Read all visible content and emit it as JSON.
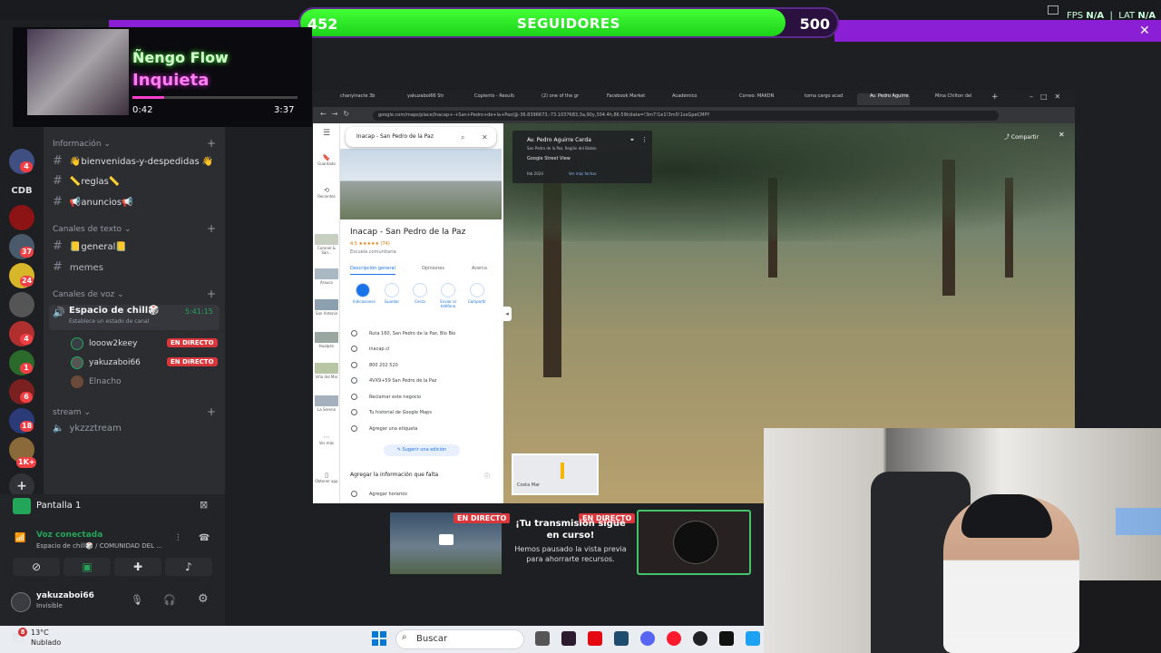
{
  "follower_goal": {
    "current": "452",
    "label": "SEGUIDORES",
    "goal": "500",
    "progress": 0.904
  },
  "obs_stats": {
    "fps_label": "FPS",
    "fps_value": "N/A",
    "lat_label": "LAT",
    "lat_value": "N/A"
  },
  "music": {
    "artist": "Ñengo Flow",
    "title": "Inquieta",
    "elapsed": "0:42",
    "duration": "3:37",
    "progress": 0.19
  },
  "servers": {
    "label_cdb": "CDB",
    "badges": [
      "4",
      "37",
      "24",
      "4",
      "1",
      "6",
      "18",
      "1K+"
    ]
  },
  "channels": {
    "cat_info": "Información",
    "ch_bienvenidas": "👋bienvenidas-y-despedidas 👋",
    "ch_reglas": "📏reglas📏",
    "ch_anuncios": "📢anuncios📢",
    "cat_text": "Canales de texto",
    "ch_general": "📒general📒",
    "ch_memes": "memes",
    "cat_voice": "Canales de voz",
    "voice_room": "Espacio de chill🎲",
    "voice_time": "5:41:15",
    "voice_status": "Establece un estado de canal",
    "users": [
      "looow2keey",
      "yakuzaboi66",
      "Elnacho"
    ],
    "live_label": "EN DIRECTO",
    "cat_stream": "stream",
    "ch_stream": "ykzzztream"
  },
  "voice_panel": {
    "screen_label": "Pantalla 1",
    "connected": "Voz conectada",
    "connected_detail": "Espacio de chill🎲 / COMUNIDAD DEL ...",
    "username": "yakuzaboi66",
    "user_status": "Invisible"
  },
  "browser": {
    "tabs": [
      "chanyinacte 3b",
      "yakuzaboi66 Str",
      "Copiento - Resulta",
      "(2) one of the gr",
      "Facebook Market",
      "Académico",
      "Correo: MAKON",
      "toma cargo acad",
      "Av. Pedro Aguirre",
      "Mina Chilton del"
    ],
    "url": "google.com/maps/place/Inacap+-+San+Pedro+de+la+Paz/@-36.8396673,-73.1037683,3a,90y,304.4h,86.59t/data=!3m7!1e1!3m5!1sxGpeCMPY",
    "search_value": "Inacap - San Pedro de la Paz",
    "place_name": "Inacap - San Pedro de la Paz",
    "rating": "4.5 ★★★★★ (74)",
    "category": "Escuela comunitaria",
    "tab_overview": "Descripción general",
    "tab_reviews": "Opiniones",
    "tab_about": "Acerca",
    "actions": [
      "Indicaciones",
      "Guardar",
      "Cerca",
      "Enviar al teléfono",
      "Compartir"
    ],
    "details": [
      "Ruta 160, San Pedro de la Paz, Bío Bío",
      "inacap.cl",
      "800 202 520",
      "4VX9+59 San Pedro de la Paz",
      "Reclamar este negocio",
      "Tu historial de Google Maps",
      "Agregar una etiqueta"
    ],
    "suggest_edit": "Sugerir una edición",
    "add_info": "Agregar la información que falta",
    "add_hours": "Agregar horarios",
    "side_items": [
      "Guardado",
      "Recientes",
      "Coronel & San...",
      "Arauco",
      "San Antonio",
      "Hualpén",
      "Viña del Mar",
      "La Serena",
      "Ver más",
      "Obtener app"
    ],
    "street_address": "Av. Pedro Aguirre Cerda",
    "street_region": "San Pedro de la Paz, Región del Biobío",
    "street_source": "Google Street View",
    "street_more": "Ver más fechas",
    "street_date": "feb 2024",
    "share": "Compartir",
    "minimap_label": "Costa Mar"
  },
  "stream_preview": {
    "live_label": "EN DIRECTO",
    "paused_title": "¡Tu transmisión sigue en curso!",
    "paused_sub": "Hemos pausado la vista previa para ahorrarte recursos."
  },
  "taskbar": {
    "temp": "13°C",
    "weather": "Nublado",
    "weather_badge": "8",
    "search_label": "Buscar"
  }
}
